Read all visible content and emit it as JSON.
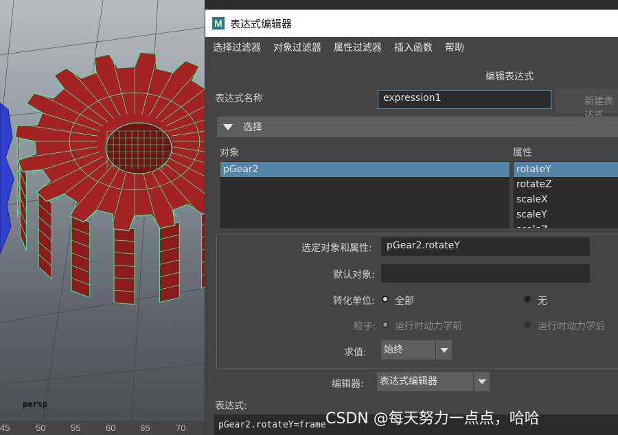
{
  "viewport": {
    "camera_label": "persp",
    "ruler_ticks": [
      "45",
      "50",
      "55",
      "60",
      "65",
      "70"
    ],
    "colors": {
      "gear_face": "#a52222",
      "wire": "#39f0a0",
      "blue_gear": "#2f3fd0"
    }
  },
  "dialog": {
    "title": "表达式编辑器",
    "app_icon_letter": "M",
    "menu": [
      "选择过滤器",
      "对象过滤器",
      "属性过滤器",
      "插入函数",
      "帮助"
    ],
    "section_title": "编辑表达式",
    "name_label": "表达式名称",
    "name_value": "expression1",
    "new_button": "新建表达式",
    "select_frame": "选择",
    "objects_header": "对象",
    "attributes_header": "属性",
    "objects": [
      "pGear2"
    ],
    "attributes": [
      "rotateY",
      "rotateZ",
      "scaleX",
      "scaleY",
      "scaleZ"
    ],
    "selected_label": "选定对象和属性:",
    "selected_value": "pGear2.rotateY",
    "default_object_label": "默认对象:",
    "default_object_value": "",
    "convert_units_label": "转化单位:",
    "convert_all": "全部",
    "convert_none": "无",
    "particle_label": "粒子:",
    "particle_before": "运行时动力学前",
    "particle_after": "运行时动力学后",
    "evaluate_label": "求值:",
    "evaluate_value": "始终",
    "editor_label": "编辑器:",
    "editor_value": "表达式编辑器",
    "expression_label": "表达式:",
    "expression_text": "pGear2.rotateY=frame"
  },
  "watermark": "CSDN @每天努力一点点，哈哈"
}
